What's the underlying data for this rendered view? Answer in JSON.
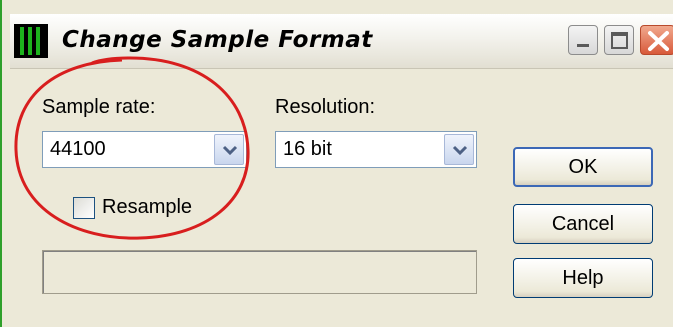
{
  "window": {
    "title": "Change Sample Format",
    "icon": "waveform-app-icon"
  },
  "titlebar_buttons": {
    "minimize": "minimize-icon",
    "maximize": "maximize-icon",
    "close": "close-icon"
  },
  "sample_rate": {
    "label": "Sample rate:",
    "value": "44100"
  },
  "resolution": {
    "label": "Resolution:",
    "value": "16 bit"
  },
  "resample": {
    "label": "Resample",
    "checked": false
  },
  "buttons": {
    "ok": "OK",
    "cancel": "Cancel",
    "help": "Help"
  },
  "status": "",
  "colors": {
    "annotation_circle": "#d81e1e",
    "dialog_background": "#ece9d8",
    "close_button": "#d85a3a"
  }
}
